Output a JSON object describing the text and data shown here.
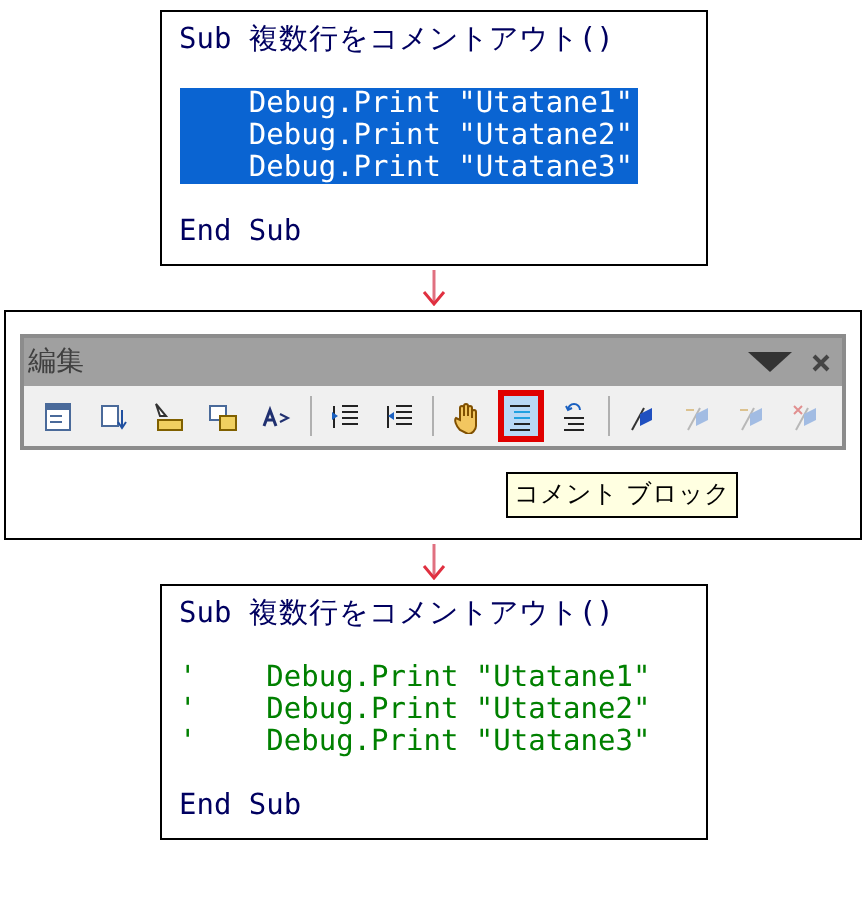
{
  "before_code": {
    "lines": [
      {
        "kind": "code",
        "text": "Sub 複数行をコメントアウト()",
        "selected": false
      },
      {
        "kind": "blank",
        "selected": false
      },
      {
        "kind": "code",
        "text": "    Debug.Print \"Utatane1\"",
        "selected": true
      },
      {
        "kind": "code",
        "text": "    Debug.Print \"Utatane2\"",
        "selected": true
      },
      {
        "kind": "code",
        "text": "    Debug.Print \"Utatane3\"",
        "selected": true
      },
      {
        "kind": "blank",
        "selected": false
      },
      {
        "kind": "code",
        "text": "End Sub",
        "selected": false
      }
    ]
  },
  "toolbar": {
    "title": "編集",
    "groups": [
      [
        {
          "kind": "list",
          "selected": false,
          "disabled": false
        },
        {
          "kind": "constants",
          "selected": false,
          "disabled": false
        },
        {
          "kind": "info",
          "selected": false,
          "disabled": false
        },
        {
          "kind": "params",
          "selected": false,
          "disabled": false
        },
        {
          "kind": "word",
          "selected": false,
          "disabled": false
        }
      ],
      [
        {
          "kind": "indent",
          "selected": false,
          "disabled": false
        },
        {
          "kind": "outdent",
          "selected": false,
          "disabled": false
        }
      ],
      [
        {
          "kind": "hand",
          "selected": false,
          "disabled": false
        },
        {
          "kind": "comment",
          "selected": true,
          "disabled": false
        },
        {
          "kind": "uncomment",
          "selected": false,
          "disabled": false
        }
      ],
      [
        {
          "kind": "bookmark",
          "selected": false,
          "disabled": false
        },
        {
          "kind": "next",
          "selected": false,
          "disabled": true
        },
        {
          "kind": "prev",
          "selected": false,
          "disabled": true
        },
        {
          "kind": "clear",
          "selected": false,
          "disabled": true
        }
      ]
    ],
    "tooltip": "コメント ブロック"
  },
  "after_code": {
    "lines": [
      {
        "kind": "code",
        "text": "Sub 複数行をコメントアウト()"
      },
      {
        "kind": "blank"
      },
      {
        "kind": "comment",
        "text": "'    Debug.Print \"Utatane1\""
      },
      {
        "kind": "comment",
        "text": "'    Debug.Print \"Utatane2\""
      },
      {
        "kind": "comment",
        "text": "'    Debug.Print \"Utatane3\""
      },
      {
        "kind": "blank"
      },
      {
        "kind": "code",
        "text": "End Sub"
      }
    ]
  }
}
